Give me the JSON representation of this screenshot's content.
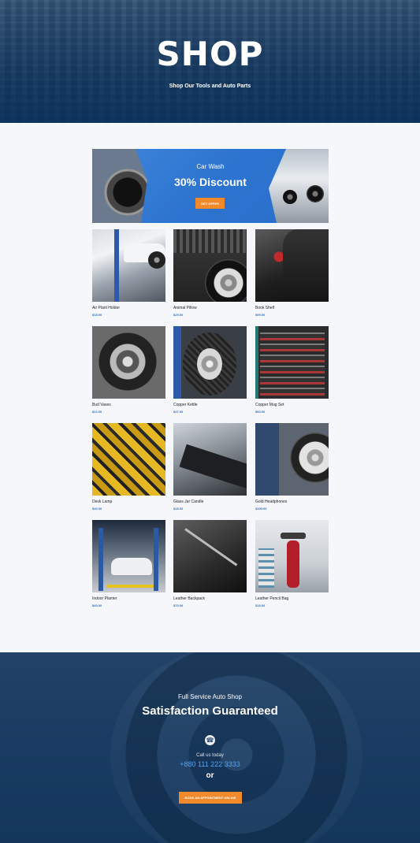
{
  "hero": {
    "title": "SHOP",
    "subtitle": "Shop Our Tools and Auto Parts"
  },
  "banner": {
    "subtitle": "Car Wash",
    "headline": "30% Discount",
    "button_label": "GET OFFER"
  },
  "products": [
    {
      "name": "Air Plant Holder",
      "price": "$15.00"
    },
    {
      "name": "Animal Pillow",
      "price": "$29.00"
    },
    {
      "name": "Book Shelf",
      "price": "$99.00"
    },
    {
      "name": "Bud Vases",
      "price": "$22.00"
    },
    {
      "name": "Copper Kettle",
      "price": "$47.00"
    },
    {
      "name": "Copper Mug Set",
      "price": "$60.00"
    },
    {
      "name": "Desk Lamp",
      "price": "$40.00"
    },
    {
      "name": "Glass Jar Candle",
      "price": "$18.00"
    },
    {
      "name": "Gold Headphones",
      "price": "$200.00"
    },
    {
      "name": "Indoor Planter",
      "price": "$40.00"
    },
    {
      "name": "Leather Backpack",
      "price": "$70.00"
    },
    {
      "name": "Leather Pencil Bag",
      "price": "$15.00"
    }
  ],
  "footer": {
    "eyebrow": "Full Service Auto Shop",
    "headline": "Satisfaction Guaranteed",
    "call_label": "Call us today",
    "phone": "+880 111 222 3333",
    "or": "or",
    "button_label": "BOOK AN APPOINTMENT ONLINE",
    "icon": "phone-icon"
  },
  "colors": {
    "accent": "#f08a2a",
    "price_blue": "#2e6fc9",
    "banner_blue": "#2d74d0",
    "navy": "#1c3d62"
  }
}
